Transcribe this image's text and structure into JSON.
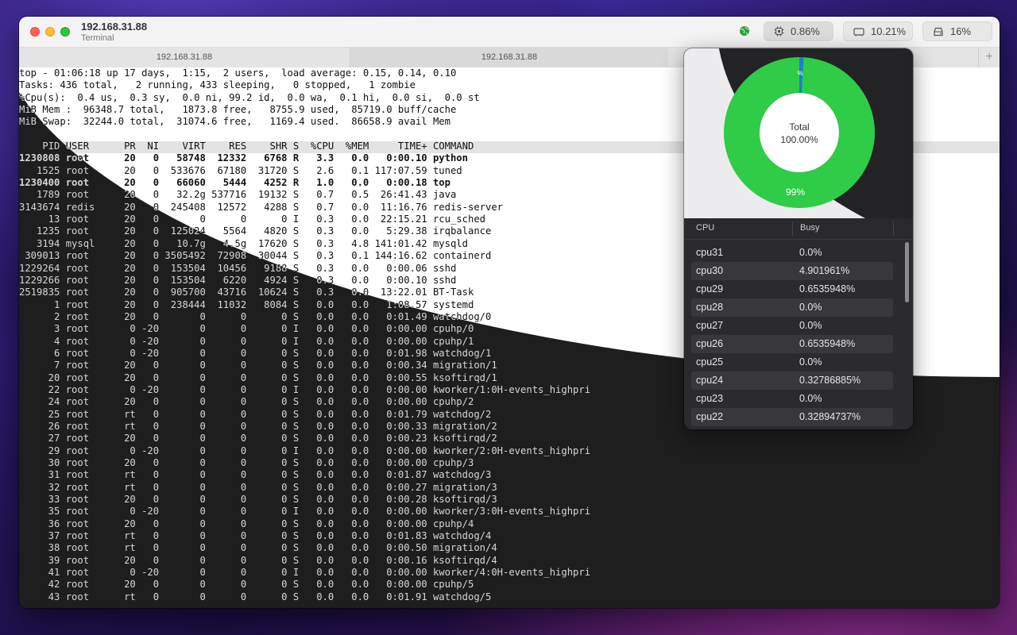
{
  "window": {
    "title": "192.168.31.88",
    "subtitle": "Terminal",
    "stats": {
      "cpu": "0.86%",
      "memory": "10.21%",
      "disk": "16%"
    }
  },
  "tabs": [
    {
      "label": "192.168.31.88"
    },
    {
      "label": "192.168.31.88"
    }
  ],
  "tab_plus": "+",
  "terminal": {
    "summary": [
      "top - 01:06:18 up 17 days,  1:15,  2 users,  load average: 0.15, 0.14, 0.10",
      "Tasks: 436 total,   2 running, 433 sleeping,   0 stopped,   1 zombie",
      "%Cpu(s):  0.4 us,  0.3 sy,  0.0 ni, 99.2 id,  0.0 wa,  0.1 hi,  0.0 si,  0.0 st",
      "MiB Mem :  96348.7 total,   1873.8 free,   8755.9 used,  85719.0 buff/cache",
      "MiB Swap:  32244.0 total,  31074.6 free,   1169.4 used.  86658.9 avail Mem"
    ],
    "header": "    PID USER      PR  NI    VIRT    RES    SHR S  %CPU  %MEM     TIME+ COMMAND",
    "process_rows": [
      {
        "text": "1230808 root      20   0   58748  12332   6768 R   3.3   0.0   0:00.10 python",
        "bold": true
      },
      {
        "text": "   1525 root      20   0  533676  67180  31720 S   2.6   0.1 117:07.59 tuned",
        "bold": false
      },
      {
        "text": "1230400 root      20   0   66060   5444   4252 R   1.0   0.0   0:00.18 top",
        "bold": true
      },
      {
        "text": "   1789 root      20   0   32.2g 537716  19132 S   0.7   0.5  26:41.43 java",
        "bold": false
      },
      {
        "text": "3143674 redis     20   0  245408  12572   4288 S   0.7   0.0  11:16.76 redis-server",
        "bold": false
      },
      {
        "text": "     13 root      20   0       0      0      0 I   0.3   0.0  22:15.21 rcu_sched",
        "bold": false
      },
      {
        "text": "   1235 root      20   0  125024   5564   4820 S   0.3   0.0   5:29.38 irqbalance",
        "bold": false
      },
      {
        "text": "   3194 mysql     20   0   10.7g   4.5g  17620 S   0.3   4.8 141:01.42 mysqld",
        "bold": false
      },
      {
        "text": " 309013 root      20   0 3505492  72908  30044 S   0.3   0.1 144:16.62 containerd",
        "bold": false
      },
      {
        "text": "1229264 root      20   0  153504  10456   9188 S   0.3   0.0   0:00.06 sshd",
        "bold": false
      },
      {
        "text": "1229266 root      20   0  153504   6220   4924 S   0.3   0.0   0:00.10 sshd",
        "bold": false
      },
      {
        "text": "2519835 root      20   0  905700  43716  10624 S   0.3   0.0  13:22.01 BT-Task",
        "bold": false
      },
      {
        "text": "      1 root      20   0  238444  11032   8084 S   0.0   0.0   1:08.57 systemd",
        "bold": false
      },
      {
        "text": "      2 root      20   0       0      0      0 S   0.0   0.0   0:01.49 watchdog/0",
        "bold": false
      },
      {
        "text": "      3 root       0 -20       0      0      0 I   0.0   0.0   0:00.00 cpuhp/0",
        "bold": false
      },
      {
        "text": "      4 root       0 -20       0      0      0 I   0.0   0.0   0:00.00 cpuhp/1",
        "bold": false
      },
      {
        "text": "      6 root       0 -20       0      0      0 S   0.0   0.0   0:01.98 watchdog/1",
        "bold": false
      },
      {
        "text": "      7 root      20   0       0      0      0 S   0.0   0.0   0:00.34 migration/1",
        "bold": false
      },
      {
        "text": "     20 root      20   0       0      0      0 S   0.0   0.0   0:00.55 ksoftirqd/1",
        "bold": false
      },
      {
        "text": "     22 root       0 -20       0      0      0 I   0.0   0.0   0:00.00 kworker/1:0H-events_highpri",
        "bold": false
      },
      {
        "text": "     24 root      20   0       0      0      0 S   0.0   0.0   0:00.00 cpuhp/2",
        "bold": false
      },
      {
        "text": "     25 root      rt   0       0      0      0 S   0.0   0.0   0:01.79 watchdog/2",
        "bold": false
      },
      {
        "text": "     26 root      rt   0       0      0      0 S   0.0   0.0   0:00.33 migration/2",
        "bold": false
      },
      {
        "text": "     27 root      20   0       0      0      0 S   0.0   0.0   0:00.23 ksoftirqd/2",
        "bold": false
      },
      {
        "text": "     29 root       0 -20       0      0      0 I   0.0   0.0   0:00.00 kworker/2:0H-events_highpri",
        "bold": false
      },
      {
        "text": "     30 root      20   0       0      0      0 S   0.0   0.0   0:00.00 cpuhp/3",
        "bold": false
      },
      {
        "text": "     31 root      rt   0       0      0      0 S   0.0   0.0   0:01.87 watchdog/3",
        "bold": false
      },
      {
        "text": "     32 root      rt   0       0      0      0 S   0.0   0.0   0:00.27 migration/3",
        "bold": false
      },
      {
        "text": "     33 root      20   0       0      0      0 S   0.0   0.0   0:00.28 ksoftirqd/3",
        "bold": false
      },
      {
        "text": "     35 root       0 -20       0      0      0 I   0.0   0.0   0:00.00 kworker/3:0H-events_highpri",
        "bold": false
      },
      {
        "text": "     36 root      20   0       0      0      0 S   0.0   0.0   0:00.00 cpuhp/4",
        "bold": false
      },
      {
        "text": "     37 root      rt   0       0      0      0 S   0.0   0.0   0:01.83 watchdog/4",
        "bold": false
      },
      {
        "text": "     38 root      rt   0       0      0      0 S   0.0   0.0   0:00.50 migration/4",
        "bold": false
      },
      {
        "text": "     39 root      20   0       0      0      0 S   0.0   0.0   0:00.16 ksoftirqd/4",
        "bold": false
      },
      {
        "text": "     41 root       0 -20       0      0      0 I   0.0   0.0   0:00.00 kworker/4:0H-events_highpri",
        "bold": false
      },
      {
        "text": "     42 root      20   0       0      0      0 S   0.0   0.0   0:00.00 cpuhp/5",
        "bold": false
      },
      {
        "text": "     43 root      rt   0       0      0      0 S   0.0   0.0   0:01.91 watchdog/5",
        "bold": false
      }
    ]
  },
  "popover": {
    "donut": {
      "center_label": "Total",
      "center_value": "100.00%",
      "idle_label": "99%",
      "busy_label": "%",
      "busy_fraction": 0.0086,
      "colors": {
        "idle": "#2ecc47",
        "busy": "#1e7be0"
      }
    },
    "columns": [
      "CPU",
      "Busy"
    ],
    "rows": [
      {
        "cpu": "cpu31",
        "busy": "0.0%"
      },
      {
        "cpu": "cpu30",
        "busy": "4.901961%"
      },
      {
        "cpu": "cpu29",
        "busy": "0.6535948%"
      },
      {
        "cpu": "cpu28",
        "busy": "0.0%"
      },
      {
        "cpu": "cpu27",
        "busy": "0.0%"
      },
      {
        "cpu": "cpu26",
        "busy": "0.6535948%"
      },
      {
        "cpu": "cpu25",
        "busy": "0.0%"
      },
      {
        "cpu": "cpu24",
        "busy": "0.32786885%"
      },
      {
        "cpu": "cpu23",
        "busy": "0.0%"
      },
      {
        "cpu": "cpu22",
        "busy": "0.32894737%"
      }
    ]
  },
  "colors": {
    "close": "#ff5f57",
    "minimize": "#febc2e",
    "maximize": "#28c840",
    "globe": "#2ea043"
  }
}
